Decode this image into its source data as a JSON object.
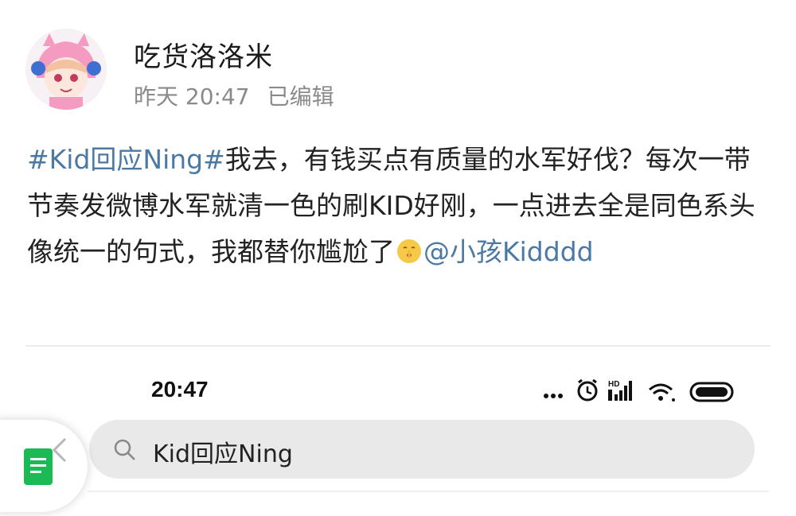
{
  "post": {
    "username": "吃货洛洛米",
    "time": "昨天 20:47",
    "edited": "已编辑",
    "text_parts": {
      "hashtag": "#Kid回应Ning#",
      "body": "我去，有钱买点有质量的水军好伐？每次一带节奏发微博水军就清一色的刷KID好刚，一点进去全是同色系头像统一的句式，我都替你尴尬了",
      "mention": "@小孩Kidddd"
    },
    "emoji_icon": "shush-face-emoji",
    "link_color": "#4c79a4"
  },
  "embedded_screen": {
    "status_time": "20:47",
    "status_icons": [
      "more-dots-icon",
      "alarm-icon",
      "hd-signal-icon",
      "wifi-icon",
      "battery-icon"
    ],
    "search_query": "Kid回应Ning",
    "search_icon": "search-icon"
  },
  "floating_widget": {
    "icon": "green-doc-icon",
    "accent": "#1db954"
  }
}
